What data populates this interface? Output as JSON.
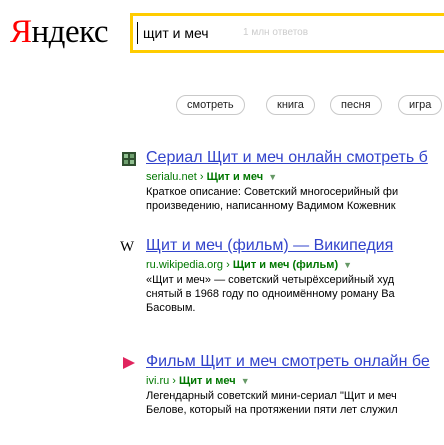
{
  "logo": {
    "first_letter": "Я",
    "rest": "ндекс"
  },
  "search": {
    "query": "щит и меч",
    "hint": "1 млн ответов"
  },
  "chips": [
    "смотреть",
    "книга",
    "песня",
    "игра"
  ],
  "results": [
    {
      "title": "Сериал Щит и меч онлайн смотреть б",
      "url_domain": "serialu.net",
      "url_sep": "›",
      "url_path": "Щит и меч",
      "url_arrow": "▼",
      "snippet_lines": [
        "Краткое описание: Советский многосерийный фи",
        "произведению, написанному Вадимом Кожевник"
      ]
    },
    {
      "title": "Щит и меч (фильм) — Википедия",
      "url_domain": "ru.wikipedia.org",
      "url_sep": "›",
      "url_path": "Щит и меч (фильм)",
      "url_arrow": "▼",
      "snippet_lines": [
        "«Щит и меч» — советский четырёхсерийный худ",
        "снятый в 1968 году по одноимённому роману Ва",
        "Басовым."
      ]
    },
    {
      "title": "Фильм Щит и меч смотреть онлайн бе",
      "url_domain": "ivi.ru",
      "url_sep": "›",
      "url_path": "Щит и меч",
      "url_arrow": "▼",
      "snippet_lines": [
        "Легендарный советский мини-сериал \"Щит и меч",
        "Белове, который на протяжении пяти лет служил"
      ]
    }
  ],
  "colors": {
    "link": "#3344cc",
    "url": "#007700",
    "logo_accent": "#ff0000",
    "search_border": "#ffcc00"
  }
}
